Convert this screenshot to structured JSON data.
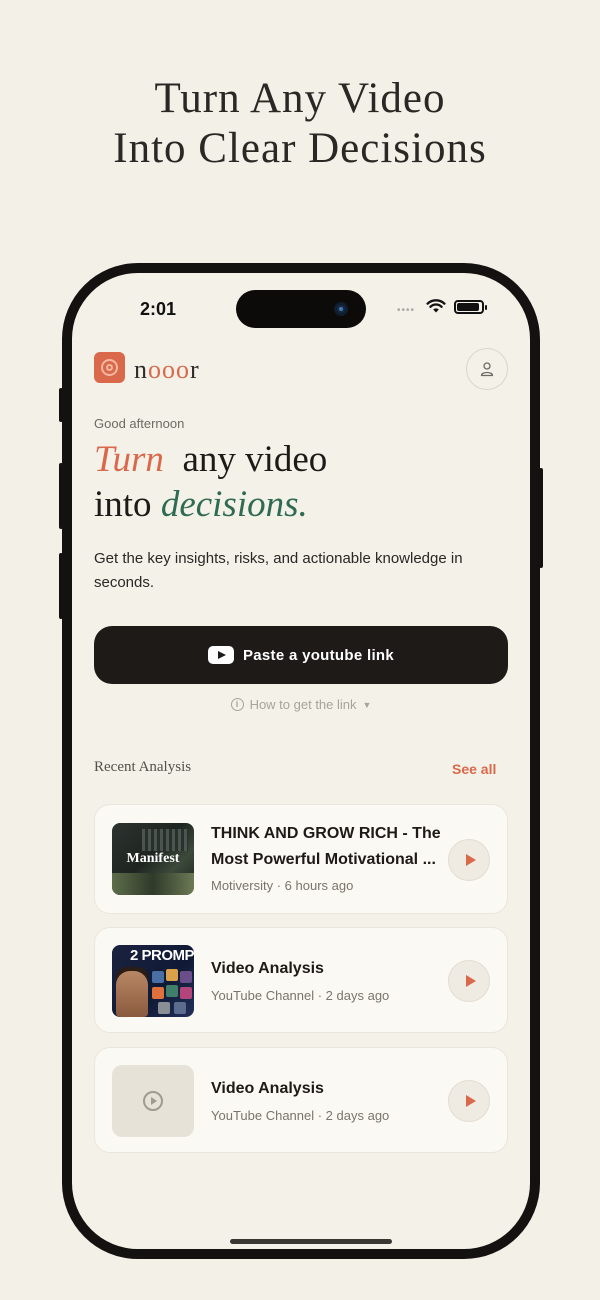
{
  "headline": {
    "line1": "Turn Any Video",
    "line2": "Into Clear Decisions"
  },
  "status_bar": {
    "time": "2:01",
    "dots": "••••"
  },
  "app": {
    "brand": {
      "n": "n",
      "ooo": "ooo",
      "r": "r"
    },
    "greeting": "Good afternoon",
    "hero": {
      "turn": "Turn",
      "any_video": "any video",
      "into": "into",
      "decisions": "decisions."
    },
    "subtitle": "Get the key insights, risks, and actionable knowledge in seconds.",
    "paste_button_label": "Paste a youtube link",
    "how_to_label": "How to get the link",
    "recent_title": "Recent Analysis",
    "see_all_label": "See all",
    "recent": [
      {
        "title": "THINK AND GROW RICH - The Most Powerful Motivational ...",
        "meta": "Motiversity · 6 hours ago",
        "thumb_text": "Manifest"
      },
      {
        "title": "Video Analysis",
        "meta": "YouTube Channel · 2 days ago",
        "thumb_text": "2 PROMP"
      },
      {
        "title": "Video Analysis",
        "meta": "YouTube Channel · 2 days ago",
        "thumb_text": ""
      }
    ]
  },
  "colors": {
    "accent": "#d9694a",
    "green": "#2e6b52",
    "dark": "#1d1a17",
    "background": "#f3f0e8"
  },
  "icons": [
    "logo-icon",
    "user-icon",
    "youtube-icon",
    "info-icon",
    "chevron-down-icon",
    "play-icon",
    "wifi-icon",
    "battery-icon"
  ]
}
